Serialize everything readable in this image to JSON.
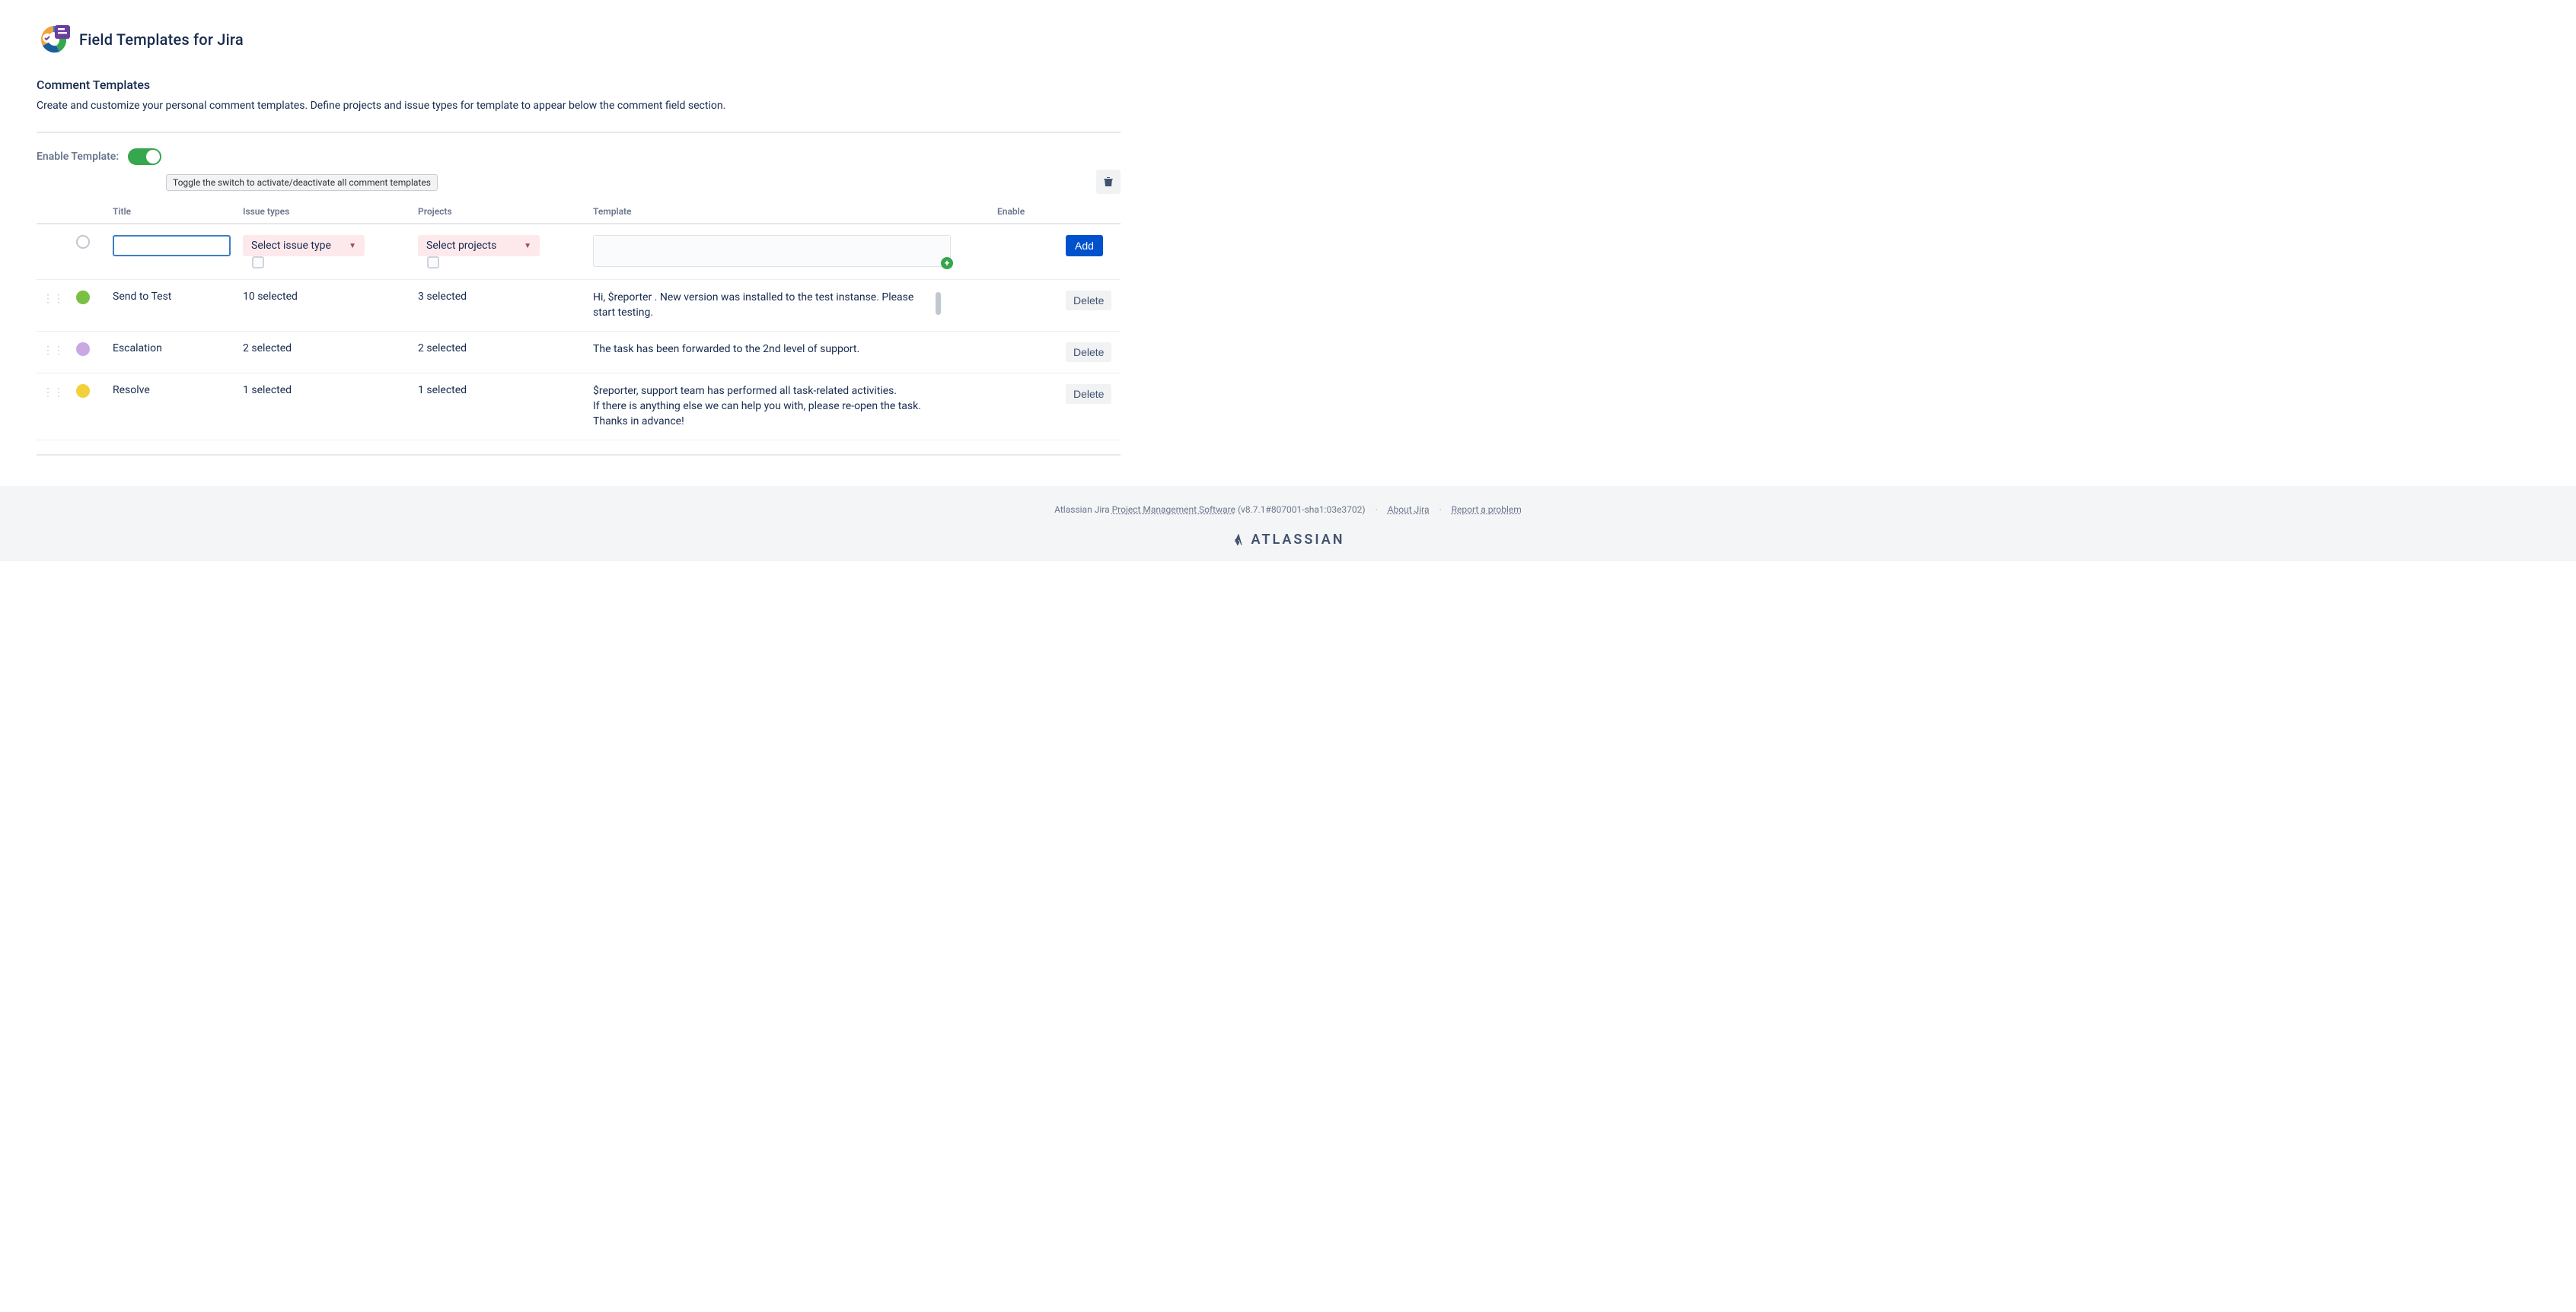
{
  "app": {
    "title": "Field Templates for Jira"
  },
  "section": {
    "title": "Comment Templates",
    "description": "Create and customize your personal comment templates. Define projects and issue types for template to appear below the comment field section."
  },
  "enable": {
    "label": "Enable Template:",
    "tooltip": "Toggle the switch to activate/deactivate all comment templates"
  },
  "table": {
    "headers": {
      "title": "Title",
      "issue_types": "Issue types",
      "projects": "Projects",
      "template": "Template",
      "enable": "Enable"
    },
    "new_row": {
      "issue_placeholder": "Select issue type",
      "project_placeholder": "Select projects",
      "add_label": "Add"
    },
    "rows": [
      {
        "color": "#7bc043",
        "title": "Send to Test",
        "issue_types": "10 selected",
        "projects": "3 selected",
        "template": "Hi,  $reporter . New version was installed to the test instanse. Please start testing.",
        "has_scroll": true,
        "delete_label": "Delete"
      },
      {
        "color": "#c9a9e3",
        "title": "Escalation",
        "issue_types": "2 selected",
        "projects": "2 selected",
        "template": "The task has been forwarded to the 2nd level of support.",
        "has_scroll": false,
        "delete_label": "Delete"
      },
      {
        "color": "#f2d03b",
        "title": "Resolve",
        "issue_types": "1 selected",
        "projects": "1 selected",
        "template": "$reporter, support team has performed all task-related activities.\nIf there is anything else we can help you with, please re-open the task.\nThanks in advance!",
        "has_scroll": false,
        "delete_label": "Delete"
      }
    ]
  },
  "footer": {
    "prefix": "Atlassian Jira ",
    "link1": "Project Management Software",
    "version": " (v8.7.1#807001-sha1:03e3702)",
    "link2": "About Jira",
    "link3": "Report a problem",
    "brand": "ATLASSIAN"
  }
}
